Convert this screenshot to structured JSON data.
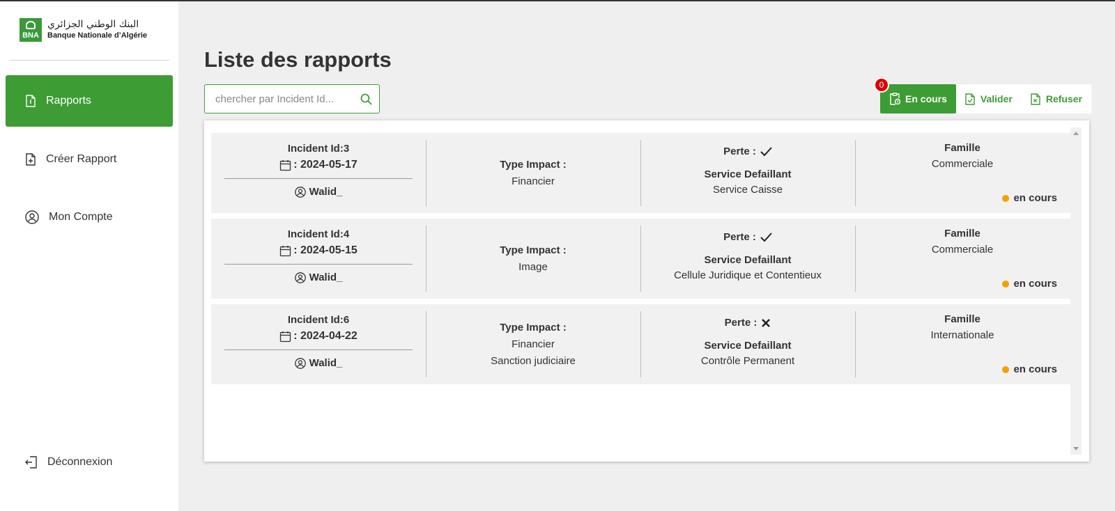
{
  "brand": {
    "logo_text": "BNA",
    "arabic_name": "البنك الوطني الجزائري",
    "latin_name": "Banque Nationale d’Algérie",
    "color": "#3e9c35"
  },
  "sidebar": {
    "items": [
      {
        "label": "Rapports",
        "icon": "file-icon",
        "active": true
      },
      {
        "label": "Créer Rapport",
        "icon": "file-plus-icon",
        "active": false
      },
      {
        "label": "Mon Compte",
        "icon": "user-circle-icon",
        "active": false
      }
    ],
    "logout": {
      "label": "Déconnexion",
      "icon": "logout-icon"
    }
  },
  "main": {
    "title": "Liste des rapports",
    "search": {
      "placeholder": "chercher par Incident Id...",
      "value": ""
    },
    "filters": {
      "badge_count": "0",
      "items": [
        {
          "label": "En cours",
          "icon": "clipboard-clock-icon",
          "active": true
        },
        {
          "label": "Valider",
          "icon": "file-check-icon",
          "active": false
        },
        {
          "label": "Refuser",
          "icon": "file-x-icon",
          "active": false
        }
      ]
    },
    "labels": {
      "type_impact": "Type Impact :",
      "perte": "Perte :",
      "service": "Service Defaillant",
      "famille": "Famille"
    },
    "rows": [
      {
        "incident": "Incident Id:3",
        "date": ": 2024-05-17",
        "user": "Walid_",
        "impact_1": "Financier",
        "impact_2": "",
        "perte": "check",
        "service": "Service Caisse",
        "famille": "Commerciale",
        "status": "en cours"
      },
      {
        "incident": "Incident Id:4",
        "date": ": 2024-05-15",
        "user": "Walid_",
        "impact_1": "Image",
        "impact_2": "",
        "perte": "check",
        "service": "Cellule Juridique et Contentieux",
        "famille": "Commerciale",
        "status": "en cours"
      },
      {
        "incident": "Incident Id:6",
        "date": ": 2024-04-22",
        "user": "Walid_",
        "impact_1": "Financier",
        "impact_2": "Sanction judiciaire",
        "perte": "cross",
        "service": "Contrôle Permanent",
        "famille": "Internationale",
        "status": "en cours"
      }
    ],
    "status_color": "#f2a100"
  }
}
